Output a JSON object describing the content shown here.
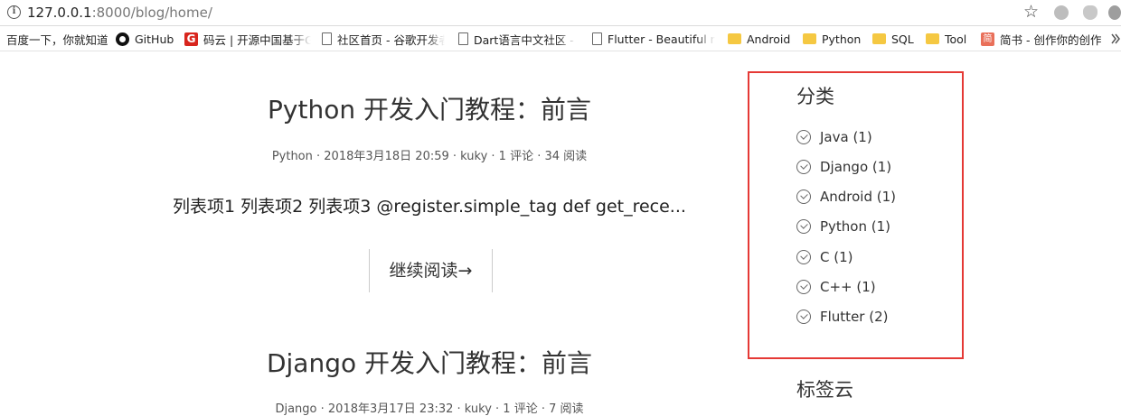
{
  "browser": {
    "url_host": "127.0.0.1",
    "url_port_path": ":8000/blog/home/"
  },
  "bookmarks": [
    {
      "label": "百度一下，你就知道",
      "icon": "none"
    },
    {
      "label": "GitHub",
      "icon": "github-icon"
    },
    {
      "label": "码云 | 开源中国基于G",
      "icon": "gitee-icon"
    },
    {
      "label": "社区首页 - 谷歌开发者",
      "icon": "page-icon"
    },
    {
      "label": "Dart语言中文社区 - ",
      "icon": "page-icon"
    },
    {
      "label": "Flutter - Beautiful n",
      "icon": "page-icon"
    },
    {
      "label": "Android",
      "icon": "folder-icon"
    },
    {
      "label": "Python",
      "icon": "folder-icon"
    },
    {
      "label": "SQL",
      "icon": "folder-icon"
    },
    {
      "label": "Tool",
      "icon": "folder-icon"
    },
    {
      "label": "简书 - 创作你的创作",
      "icon": "jianshu-icon"
    }
  ],
  "posts": [
    {
      "title": "Python 开发入门教程：前言",
      "meta": "Python · 2018年3月18日 20:59 · kuky · 1 评论 · 34 阅读",
      "excerpt": "列表项1 列表项2 列表项3 @register.simple_tag def get_rece...",
      "read_more": "继续阅读→"
    },
    {
      "title": "Django 开发入门教程：前言",
      "meta": "Django · 2018年3月17日 23:32 · kuky · 1 评论 · 7 阅读"
    }
  ],
  "sidebar": {
    "categories_title": "分类",
    "categories": [
      {
        "label": "Java (1)"
      },
      {
        "label": "Django (1)"
      },
      {
        "label": "Android (1)"
      },
      {
        "label": "Python (1)"
      },
      {
        "label": "C (1)"
      },
      {
        "label": "C++ (1)"
      },
      {
        "label": "Flutter (2)"
      }
    ],
    "tags_title": "标签云"
  },
  "colors": {
    "highlight_border": "#e53935",
    "folder": "#f5c842"
  }
}
